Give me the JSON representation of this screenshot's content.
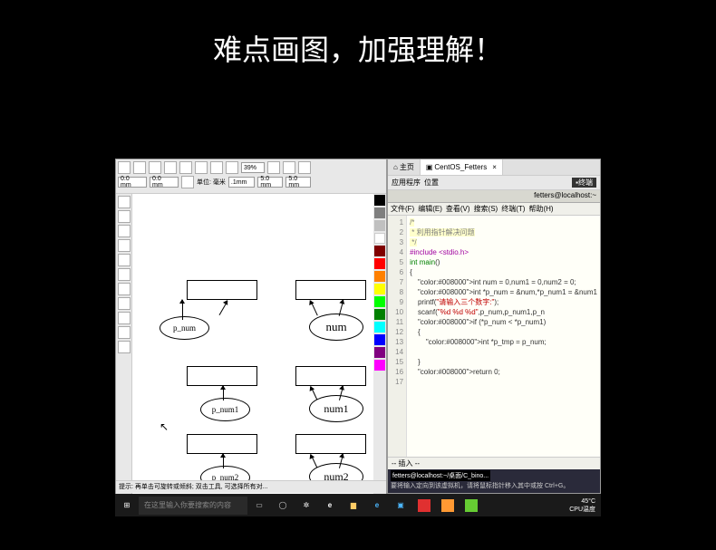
{
  "title": "难点画图，加强理解！",
  "corel": {
    "zoom": "39%",
    "unit_label": "单位: 毫米",
    "dim": ".1mm",
    "margin1": "5.0 mm",
    "margin2": "5.0 mm",
    "dx": "0.0 mm",
    "dy": "0.0 mm",
    "shapes": {
      "p_num": "p_num",
      "num": "num",
      "p_num1": "p_num1",
      "num1": "num1",
      "p_num2": "p_num2",
      "num2": "num2"
    },
    "status": "提示: 再单击可旋转或倾斜; 双击工具, 可选择所有对..."
  },
  "vm": {
    "tab_home": "主页",
    "tab_vm": "CentOS_Fetters",
    "menu_apps": "应用程序",
    "menu_loc": "位置",
    "term_title": "fetters@localhost:~",
    "fmenu": [
      "文件(F)",
      "编辑(E)",
      "查看(V)",
      "搜索(S)",
      "终端(T)",
      "帮助(H)"
    ],
    "code_lines": [
      {
        "n": 1,
        "t": "/*",
        "c": "cm"
      },
      {
        "n": 2,
        "t": " * 利用指针解决问题",
        "c": "cm"
      },
      {
        "n": 3,
        "t": " */",
        "c": "cm"
      },
      {
        "n": 4,
        "t": "#include <stdio.h>",
        "c": "pp"
      },
      {
        "n": 5,
        "t": "int main()",
        "c": "kw"
      },
      {
        "n": 6,
        "t": "{",
        "c": ""
      },
      {
        "n": 7,
        "t": "    int num = 0,num1 = 0,num2 = 0;",
        "c": ""
      },
      {
        "n": 8,
        "t": "    int *p_num = &num,*p_num1 = &num1",
        "c": ""
      },
      {
        "n": 9,
        "t": "    printf(\"请输入三个数字:\");",
        "c": ""
      },
      {
        "n": 10,
        "t": "    scanf(\"%d %d %d\",p_num,p_num1,p_n",
        "c": ""
      },
      {
        "n": 11,
        "t": "    if (*p_num < *p_num1)",
        "c": ""
      },
      {
        "n": 12,
        "t": "    {",
        "c": ""
      },
      {
        "n": 13,
        "t": "        int *p_tmp = p_num;",
        "c": ""
      },
      {
        "n": 14,
        "t": "",
        "c": ""
      },
      {
        "n": 15,
        "t": "    }",
        "c": ""
      },
      {
        "n": 16,
        "t": "    return 0;",
        "c": ""
      },
      {
        "n": 17,
        "t": "",
        "c": ""
      }
    ],
    "status": "-- 插入 --",
    "bottom_title": "fetters@localhost:~/桌面/C_bino...",
    "bottom_hint": "要将输入定向到该虚拟机，请将鼠标指针移入其中或按 Ctrl+G。"
  },
  "taskbar": {
    "search": "在这里输入你要搜索的内容",
    "temp": "45°C",
    "temp_label": "CPU温度"
  }
}
